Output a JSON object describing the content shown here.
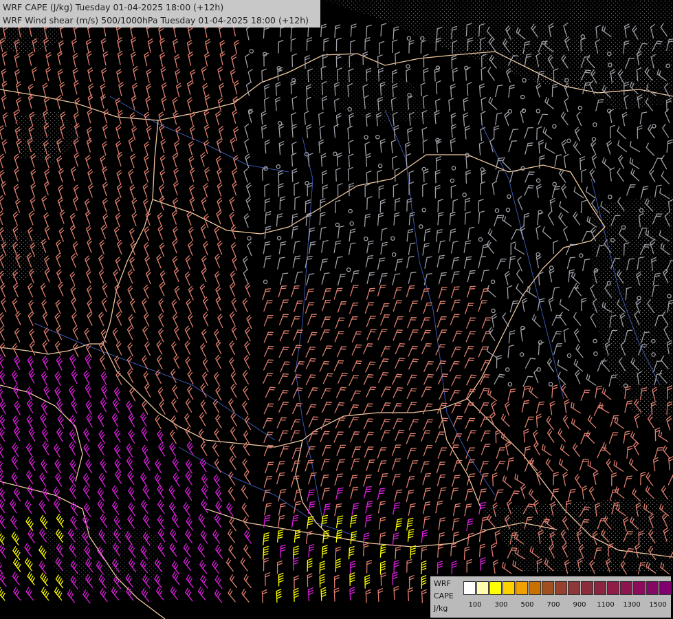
{
  "title": {
    "line1": "WRF CAPE (J/kg) Tuesday 01-04-2025 18:00 (+12h)",
    "line2": "WRF Wind shear (m/s) 500/1000hPa Tuesday 01-04-2025 18:00 (+12h)"
  },
  "legend": {
    "label_lines": [
      "WRF",
      "CAPE",
      "J/kg"
    ],
    "colors": [
      "#ffffff",
      "#fffbb0",
      "#ffff00",
      "#ffd000",
      "#f0a000",
      "#c87000",
      "#a05020",
      "#984030",
      "#8c3838",
      "#8a2c3c",
      "#8c2440",
      "#901c48",
      "#8e1450",
      "#8a0c5a",
      "#840864",
      "#800070"
    ],
    "tick_labels": [
      "100",
      "300",
      "500",
      "700",
      "900",
      "1100",
      "1300",
      "1500"
    ]
  },
  "map": {
    "background": "#000000",
    "barb_colors": {
      "low_cape": "#a0a0a8",
      "moderate_cape": "#e08070",
      "high_cape": "#e020e0",
      "very_high_cape": "#ffff00"
    },
    "border_color": "#f0c8a0",
    "river_color": "#4060c0",
    "cloud_pattern_color": "#808080"
  }
}
